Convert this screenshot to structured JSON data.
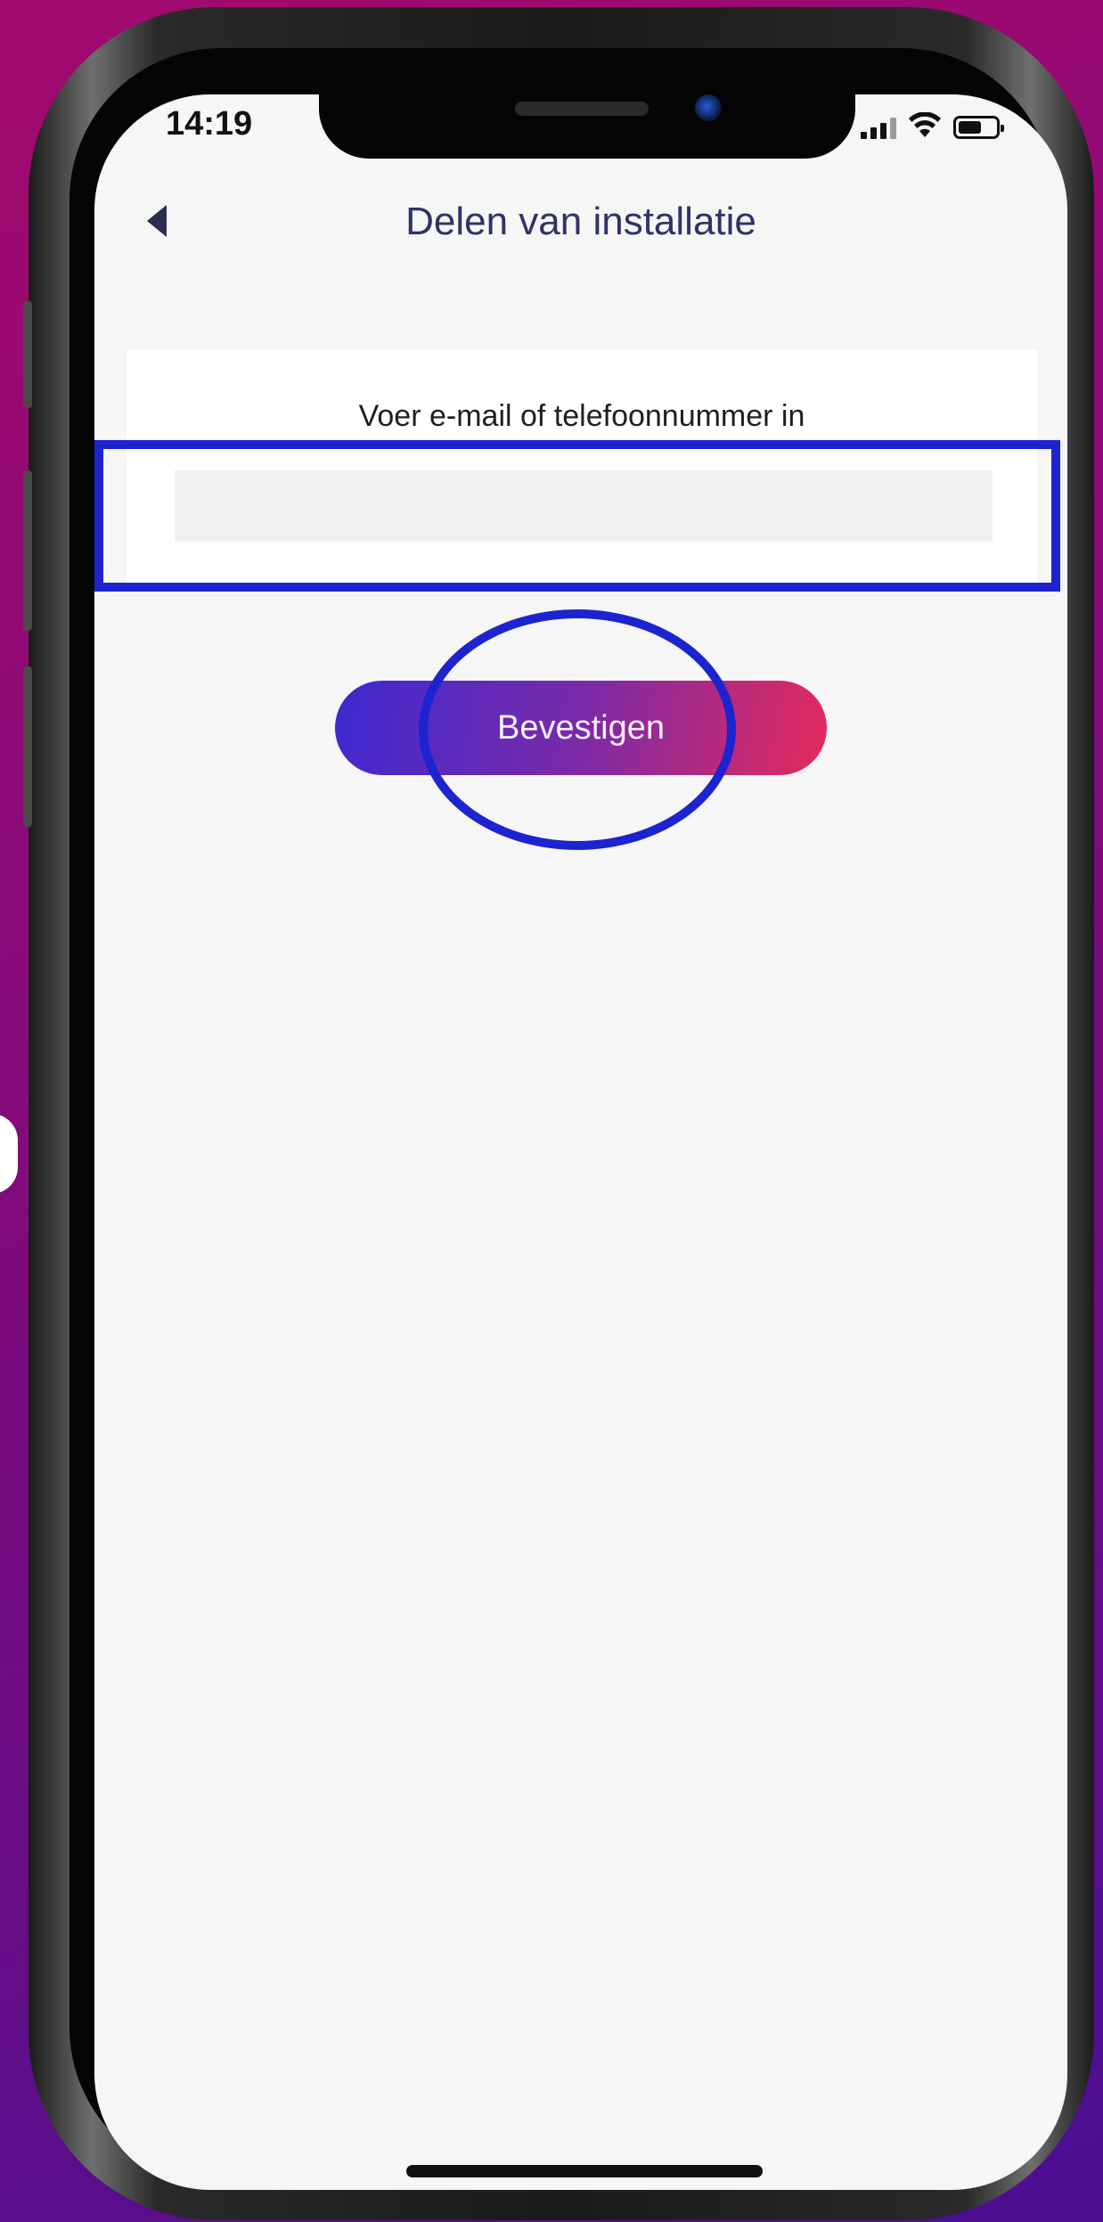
{
  "status_bar": {
    "time": "14:19",
    "icons": [
      "signal-icon",
      "wifi-icon",
      "battery-icon"
    ]
  },
  "header": {
    "title": "Delen van installatie",
    "back_icon": "back-arrow-icon"
  },
  "form": {
    "label": "Voer e-mail of telefoonnummer in",
    "input_value": "",
    "input_placeholder": ""
  },
  "actions": {
    "confirm_label": "Bevestigen"
  },
  "colors": {
    "title": "#2f3365",
    "button_gradient_start": "#3d29d1",
    "button_gradient_end": "#e62a5b",
    "annotation": "#1d24cf",
    "screen_background": "#f6f6f6"
  }
}
